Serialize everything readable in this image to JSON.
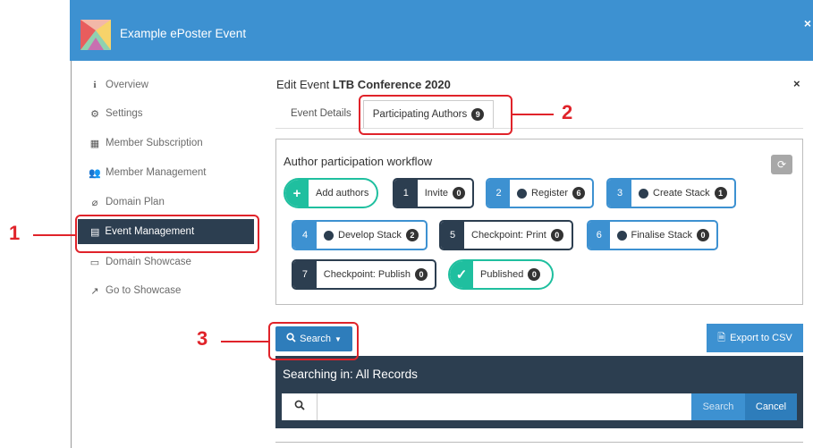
{
  "header": {
    "title": "Example ePoster Event",
    "close_symbol": "×"
  },
  "sidebar": {
    "items": [
      {
        "label": "Overview",
        "icon": "info-icon"
      },
      {
        "label": "Settings",
        "icon": "gear-icon"
      },
      {
        "label": "Member Subscription",
        "icon": "grid-icon"
      },
      {
        "label": "Member Management",
        "icon": "users-icon"
      },
      {
        "label": "Domain Plan",
        "icon": "paperclip-icon"
      },
      {
        "label": "Event Management",
        "icon": "calendar-icon",
        "active": true
      },
      {
        "label": "Domain Showcase",
        "icon": "showcase-icon"
      },
      {
        "label": "Go to Showcase",
        "icon": "external-link-icon"
      }
    ]
  },
  "main": {
    "edit_prefix": "Edit Event",
    "event_name": "LTB Conference 2020",
    "close_symbol": "×",
    "tabs": [
      {
        "label": "Event Details"
      },
      {
        "label": "Participating Authors",
        "badge": "9",
        "active": true
      }
    ]
  },
  "workflow": {
    "title": "Author participation workflow",
    "steps": [
      {
        "num": "+",
        "label": "Add authors",
        "badge": "",
        "style": "teal"
      },
      {
        "num": "1",
        "label": "Invite",
        "badge": "0",
        "style": "dark"
      },
      {
        "num": "2",
        "label": "Register",
        "badge": "6",
        "style": "blue",
        "user_icon": true
      },
      {
        "num": "3",
        "label": "Create Stack",
        "badge": "1",
        "style": "blue",
        "user_icon": true
      },
      {
        "num": "4",
        "label": "Develop Stack",
        "badge": "2",
        "style": "blue",
        "user_icon": true
      },
      {
        "num": "5",
        "label": "Checkpoint: Print",
        "badge": "0",
        "style": "dark"
      },
      {
        "num": "6",
        "label": "Finalise Stack",
        "badge": "0",
        "style": "blue",
        "user_icon": true
      },
      {
        "num": "7",
        "label": "Checkpoint: Publish",
        "badge": "0",
        "style": "dark"
      },
      {
        "num": "✓",
        "label": "Published",
        "badge": "0",
        "style": "teal"
      }
    ]
  },
  "search": {
    "button_label": "Search",
    "export_label": "Export to CSV",
    "heading": "Searching in: All Records",
    "input_value": "",
    "input_placeholder": "",
    "submit_label": "Search",
    "cancel_label": "Cancel"
  },
  "annotations": [
    {
      "label": "1"
    },
    {
      "label": "2"
    },
    {
      "label": "3"
    }
  ],
  "colors": {
    "header": "#3d91d1",
    "dark": "#2c3e50",
    "teal": "#1fbf9f",
    "annotation": "#e0232a"
  }
}
